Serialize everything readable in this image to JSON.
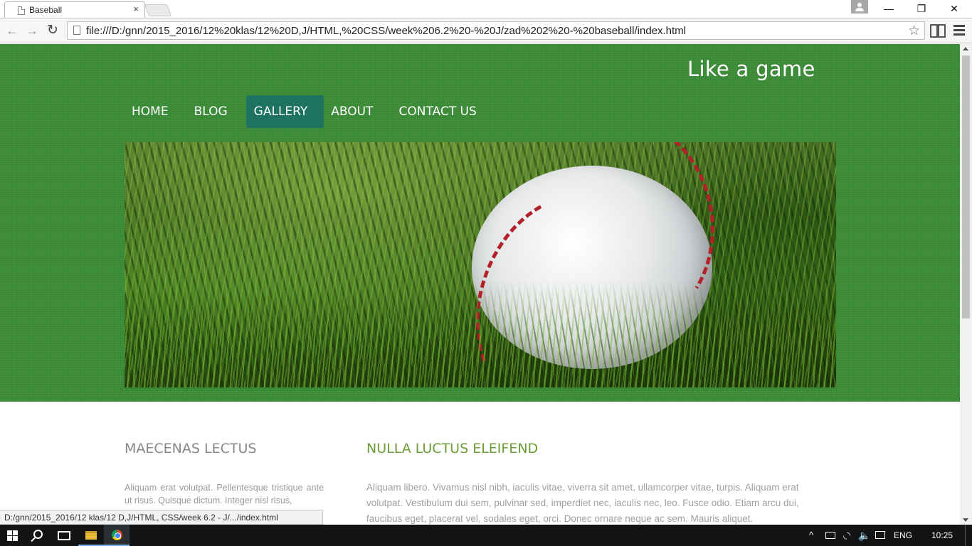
{
  "browser": {
    "tab_title": "Baseball",
    "tab_close": "×",
    "url": "file:///D:/gnn/2015_2016/12%20klas/12%20D,J/HTML,%20CSS/week%206.2%20-%20J/zad%202%20-%20baseball/index.html",
    "status_url": "D:/gnn/2015_2016/12 klas/12 D,J/HTML, CSS/week 6.2 - J/.../index.html",
    "back_glyph": "←",
    "forward_glyph": "→",
    "reload_glyph": "↻",
    "star_glyph": "☆",
    "win_min": "—",
    "win_max": "❐",
    "win_close": "✕"
  },
  "site": {
    "title": "Like a game",
    "nav": [
      {
        "label": "HOME",
        "active": false
      },
      {
        "label": "BLOG",
        "active": false
      },
      {
        "label": "GALLERY",
        "active": true
      },
      {
        "label": "ABOUT",
        "active": false
      },
      {
        "label": "CONTACT US",
        "active": false
      }
    ],
    "colors": {
      "hero_bg": "#3c8d38",
      "nav_active_bg": "#1e7260",
      "heading_green": "#6b9c35",
      "heading_gray": "#888888"
    }
  },
  "content": {
    "left_heading": "MAECENAS LECTUS",
    "left_text": "Aliquam erat volutpat. Pellentesque tristique ante ut risus. Quisque dictum. Integer nisl risus,",
    "right_heading": "NULLA LUCTUS ELEIFEND",
    "right_text": "Aliquam libero. Vivamus nisl nibh, iaculis vitae, viverra sit amet, ullamcorper vitae, turpis. Aliquam erat volutpat. Vestibulum dui sem, pulvinar sed, imperdiet nec, iaculis nec, leo. Fusce odio. Etiam arcu dui, faucibus eget, placerat vel, sodales eget, orci. Donec ornare neque ac sem. Mauris aliquet."
  },
  "taskbar": {
    "chevron": "^",
    "wifi": "◟◝",
    "volume": "🔈",
    "lang": "ENG",
    "time": "10:25"
  }
}
